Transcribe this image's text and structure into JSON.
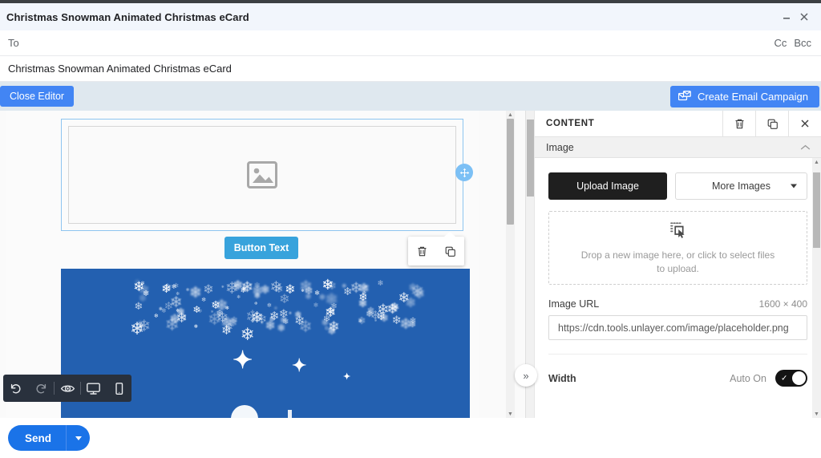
{
  "window": {
    "title": "Christmas Snowman Animated Christmas eCard",
    "minimize_icon": "minimize-icon",
    "close_icon": "close-icon"
  },
  "compose": {
    "to_label": "To",
    "cc_label": "Cc",
    "bcc_label": "Bcc",
    "subject": "Christmas Snowman Animated Christmas eCard"
  },
  "editor_actions": {
    "close_editor_label": "Close Editor",
    "create_campaign_label": "Create Email Campaign",
    "create_campaign_icon": "mail-campaign-icon",
    "accent_color": "#4285f4",
    "bar_background": "#dfe8ef"
  },
  "canvas": {
    "image_block": {
      "placeholder_icon": "image-placeholder-icon",
      "selected": true,
      "selection_color": "#8ec5f0",
      "move_handle_icon": "move-arrows-icon"
    },
    "button_block": {
      "label": "Button Text",
      "background": "#38a3dc"
    },
    "block_toolbar": {
      "delete_icon": "trash-icon",
      "duplicate_icon": "duplicate-icon"
    },
    "hero": {
      "background": "#2360b0",
      "snowflake_glyph": "❄",
      "sparkle_glyph": "✦"
    }
  },
  "bottom_toolbar": {
    "items": [
      {
        "name": "undo-icon"
      },
      {
        "name": "redo-icon"
      },
      {
        "name": "preview-eye-icon"
      },
      {
        "name": "desktop-view-icon"
      },
      {
        "name": "mobile-view-icon"
      }
    ],
    "background": "#29313d"
  },
  "panel": {
    "title": "CONTENT",
    "delete_icon": "trash-icon",
    "duplicate_icon": "duplicate-icon",
    "close_icon": "close-icon",
    "collapse_icon": "double-chevron-right-icon",
    "section": {
      "title": "Image",
      "chevron_icon": "chevron-up-icon"
    },
    "upload_image_label": "Upload Image",
    "more_images_label": "More Images",
    "more_images_caret": "chevron-down-icon",
    "dropzone": {
      "icon": "select-files-icon",
      "text": "Drop a new image here, or click to select files to upload."
    },
    "image_url_label": "Image URL",
    "image_dimensions": "1600 × 400",
    "image_url_value": "https://cdn.tools.unlayer.com/image/placeholder.png",
    "image_url_placeholder": "https://cdn.tools.unlayer.com/image/placeholder.png",
    "width_label": "Width",
    "width_auto_label": "Auto On",
    "width_toggle_on": true
  },
  "send": {
    "label": "Send",
    "dropdown_icon": "chevron-down-icon",
    "color": "#1a73e8"
  }
}
